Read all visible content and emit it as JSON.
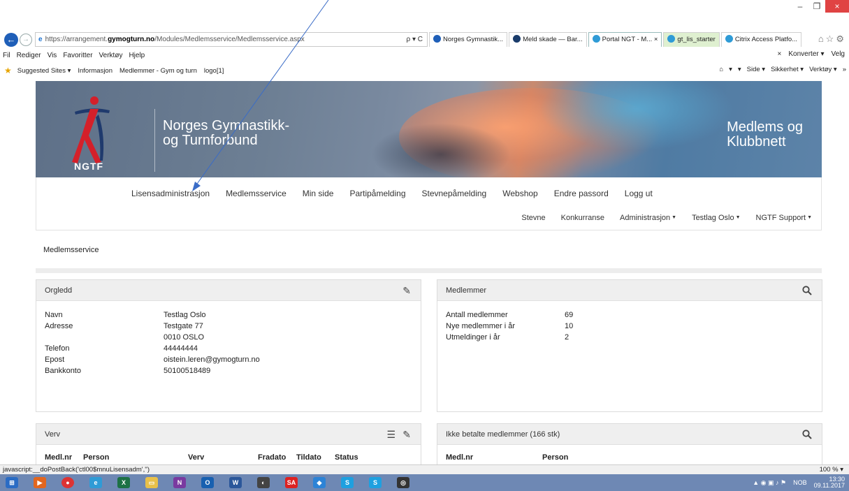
{
  "browser": {
    "url_prefix": "https://arrangement.",
    "url_domain": "gymogturn.no",
    "url_path": "/Modules/Medlemsservice/Medlemsservice.aspx",
    "url_tools": "ρ ▾ C",
    "tabs": [
      {
        "label": "Norges Gymnastik...",
        "color": "#1f5fb8"
      },
      {
        "label": "Meld skade — Bar...",
        "color": "#1a3c6b"
      },
      {
        "label": "Portal NGT - M... ×",
        "color": "#2f9bd6"
      },
      {
        "label": "gt_lis_starter",
        "color": "#2f9bd6"
      },
      {
        "label": "Citrix Access Platfo...",
        "color": "#2f9bd6"
      }
    ],
    "menu": [
      "Fil",
      "Rediger",
      "Vis",
      "Favoritter",
      "Verktøy",
      "Hjelp"
    ],
    "menu_right": [
      "×",
      "Konverter ▾",
      "Velg"
    ],
    "favorites": [
      "Suggested Sites ▾",
      "Informasjon",
      "Medlemmer - Gym og turn",
      "logo[1]"
    ],
    "commands": [
      "▾",
      "▾",
      "Side ▾",
      "Sikkerhet ▾",
      "Verktøy ▾",
      "»"
    ],
    "status_left": "javascript:__doPostBack('ctl00$mnuLisensadm','')",
    "status_right": "100 %  ▾",
    "clock_time": "13:30",
    "clock_date": "09.11.2017",
    "lang": "NOB"
  },
  "banner": {
    "logo_text": "NGTF",
    "org_line1": "Norges Gymnastikk-",
    "org_line2": "og Turnforbund",
    "tag_line1": "Medlems og",
    "tag_line2": "Klubbnett"
  },
  "nav": {
    "main": [
      "Lisensadministrasjon",
      "Medlemsservice",
      "Min side",
      "Partipåmelding",
      "Stevnepåmelding",
      "Webshop",
      "Endre passord",
      "Logg ut"
    ],
    "sub": [
      {
        "label": "Stevne",
        "dropdown": false
      },
      {
        "label": "Konkurranse",
        "dropdown": false
      },
      {
        "label": "Administrasjon",
        "dropdown": true
      },
      {
        "label": "Testlag Oslo",
        "dropdown": true
      },
      {
        "label": "NGTF Support",
        "dropdown": true
      }
    ]
  },
  "page_title": "Medlemsservice",
  "orgledd": {
    "title": "Orgledd",
    "rows": [
      {
        "k": "Navn",
        "v": "Testlag Oslo"
      },
      {
        "k": "Adresse",
        "v": "Testgate 77"
      },
      {
        "k": "",
        "v": "0010 OSLO"
      },
      {
        "k": "Telefon",
        "v": "44444444"
      },
      {
        "k": "Epost",
        "v": "oistein.leren@gymogturn.no"
      },
      {
        "k": "Bankkonto",
        "v": "50100518489"
      }
    ]
  },
  "medlemmer": {
    "title": "Medlemmer",
    "rows": [
      {
        "k": "Antall medlemmer",
        "v": "69"
      },
      {
        "k": "Nye medlemmer i år",
        "v": "10"
      },
      {
        "k": "Utmeldinger i år",
        "v": "2"
      }
    ]
  },
  "verv": {
    "title": "Verv",
    "columns": [
      "Medl.nr",
      "Person",
      "Verv",
      "Fradato",
      "Tildato",
      "Status"
    ]
  },
  "ikke_betalte": {
    "title": "Ikke betalte medlemmer (166 stk)",
    "columns": [
      "Medl.nr",
      "Person"
    ]
  }
}
